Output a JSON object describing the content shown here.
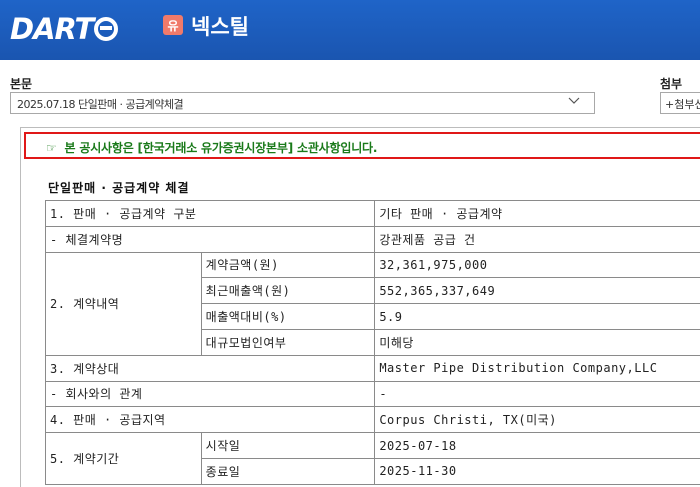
{
  "header": {
    "logo_text": "DART",
    "company_badge": "유",
    "company_name": "넥스틸"
  },
  "body_section": {
    "label": "본문",
    "selected_report": "2025.07.18  단일판매 · 공급계약체결"
  },
  "attach_section": {
    "label": "첨부",
    "selected": "+첨부선택+"
  },
  "notice": {
    "icon": "pointing-hand-icon",
    "text": "본 공시사항은 [한국거래소 유가증권시장본부] 소관사항입니다."
  },
  "document": {
    "title": "단일판매 · 공급계약 체결",
    "rows": {
      "r1": {
        "label": "1. 판매 · 공급계약 구분",
        "value": "기타 판매 · 공급계약"
      },
      "r2": {
        "label": "- 체결계약명",
        "value": "강관제품 공급 건"
      },
      "r3": {
        "label": "2. 계약내역",
        "items": [
          {
            "label": "계약금액(원)",
            "value": "32,361,975,000"
          },
          {
            "label": "최근매출액(원)",
            "value": "552,365,337,649"
          },
          {
            "label": "매출액대비(%)",
            "value": "5.9"
          },
          {
            "label": "대규모법인여부",
            "value": "미해당"
          }
        ]
      },
      "r4": {
        "label": "3. 계약상대",
        "value": "Master Pipe Distribution Company,LLC"
      },
      "r5": {
        "label": "- 회사와의 관계",
        "value": "-"
      },
      "r6": {
        "label": "4. 판매 · 공급지역",
        "value": "Corpus Christi, TX(미국)"
      },
      "r7": {
        "label": "5. 계약기간",
        "items": [
          {
            "label": "시작일",
            "value": "2025-07-18"
          },
          {
            "label": "종료일",
            "value": "2025-11-30"
          }
        ]
      }
    }
  }
}
